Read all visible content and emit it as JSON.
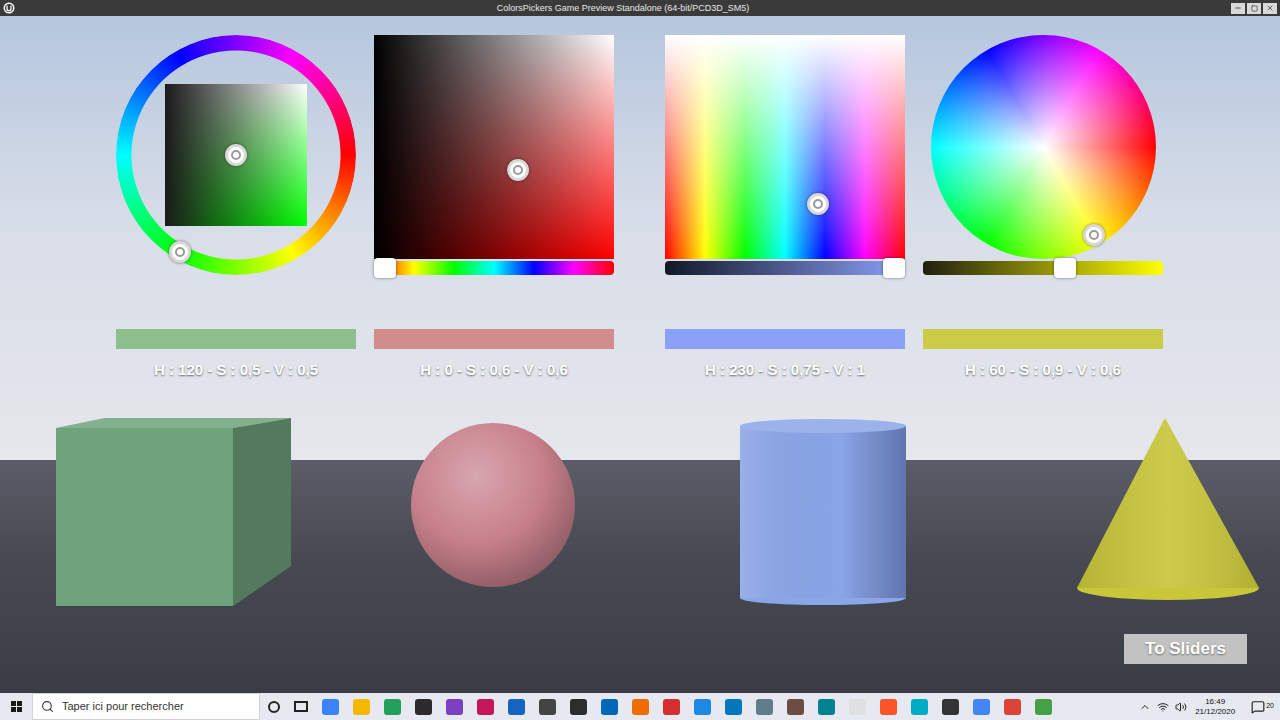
{
  "window": {
    "title": "ColorsPickers Game Preview Standalone (64-bit/PCD3D_SM5)"
  },
  "pickers": [
    {
      "kind": "ring",
      "hue": 120,
      "saturation": 0.5,
      "value": 0.5,
      "color": "#8cbf8c",
      "label": "H : 120 - S : 0,5 - V : 0,5"
    },
    {
      "kind": "square-hue",
      "hue": 0,
      "saturation": 0.6,
      "value": 0.6,
      "color": "#d38c8c",
      "label": "H : 0 - S : 0,6 - V : 0,6"
    },
    {
      "kind": "square-value",
      "hue": 230,
      "saturation": 0.75,
      "value": 1,
      "color": "#8ba0f8",
      "label": "H : 230 - S : 0,75 - V : 1"
    },
    {
      "kind": "wheel",
      "hue": 60,
      "saturation": 0.9,
      "value": 0.6,
      "color": "#cccb47",
      "label": "H : 60 - S : 0,9 - V : 0,6"
    }
  ],
  "objects": [
    {
      "kind": "cube",
      "color": "#6fa37c"
    },
    {
      "kind": "sphere",
      "color": "#c7808b"
    },
    {
      "kind": "cylinder",
      "color": "#8aa6e8"
    },
    {
      "kind": "cone",
      "color": "#c9c63a"
    }
  ],
  "button": {
    "label": "To Sliders"
  },
  "taskbar": {
    "search_placeholder": "Taper ici pour rechercher",
    "time": "16:49",
    "date": "21/12/2020",
    "notifications": "20"
  }
}
